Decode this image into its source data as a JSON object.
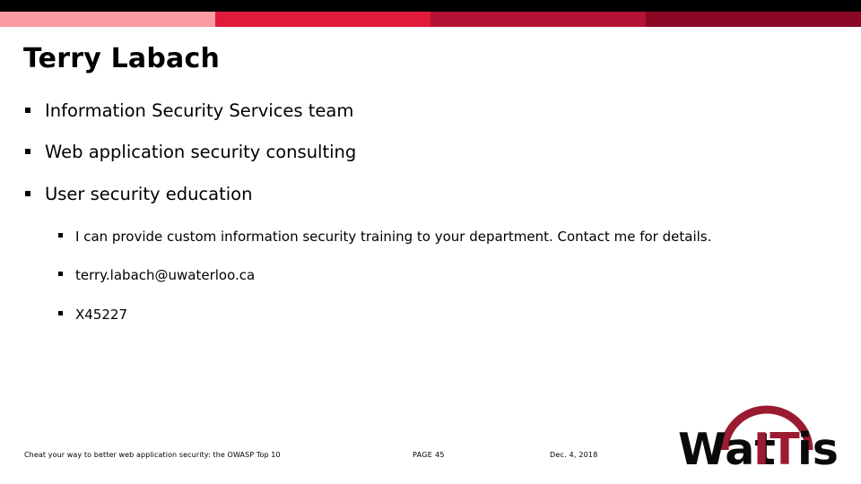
{
  "slide": {
    "title": "Terry Labach",
    "topbar": {
      "black_color": "#000000",
      "segment_colors": [
        "#FA9BA4",
        "#E01A3C",
        "#B41235",
        "#8A0823"
      ]
    },
    "bullets": [
      {
        "text": "Information Security Services team"
      },
      {
        "text": "Web application security consulting"
      },
      {
        "text": "User security education"
      }
    ],
    "sub_bullets": [
      {
        "text": "I can provide custom information security training to your department. Contact me for details."
      },
      {
        "text": "terry.labach@uwaterloo.ca"
      },
      {
        "text": "X45227"
      }
    ],
    "footer": {
      "note": "Cheat your way to better web application security: the OWASP Top 10",
      "page": "PAGE  45",
      "date": "Dec. 4, 2018"
    },
    "logo": {
      "text_part1": "Wat",
      "text_part2": "IT",
      "text_part3": "is",
      "black_color": "#0A0A0A",
      "red_color": "#9B1B30"
    }
  }
}
